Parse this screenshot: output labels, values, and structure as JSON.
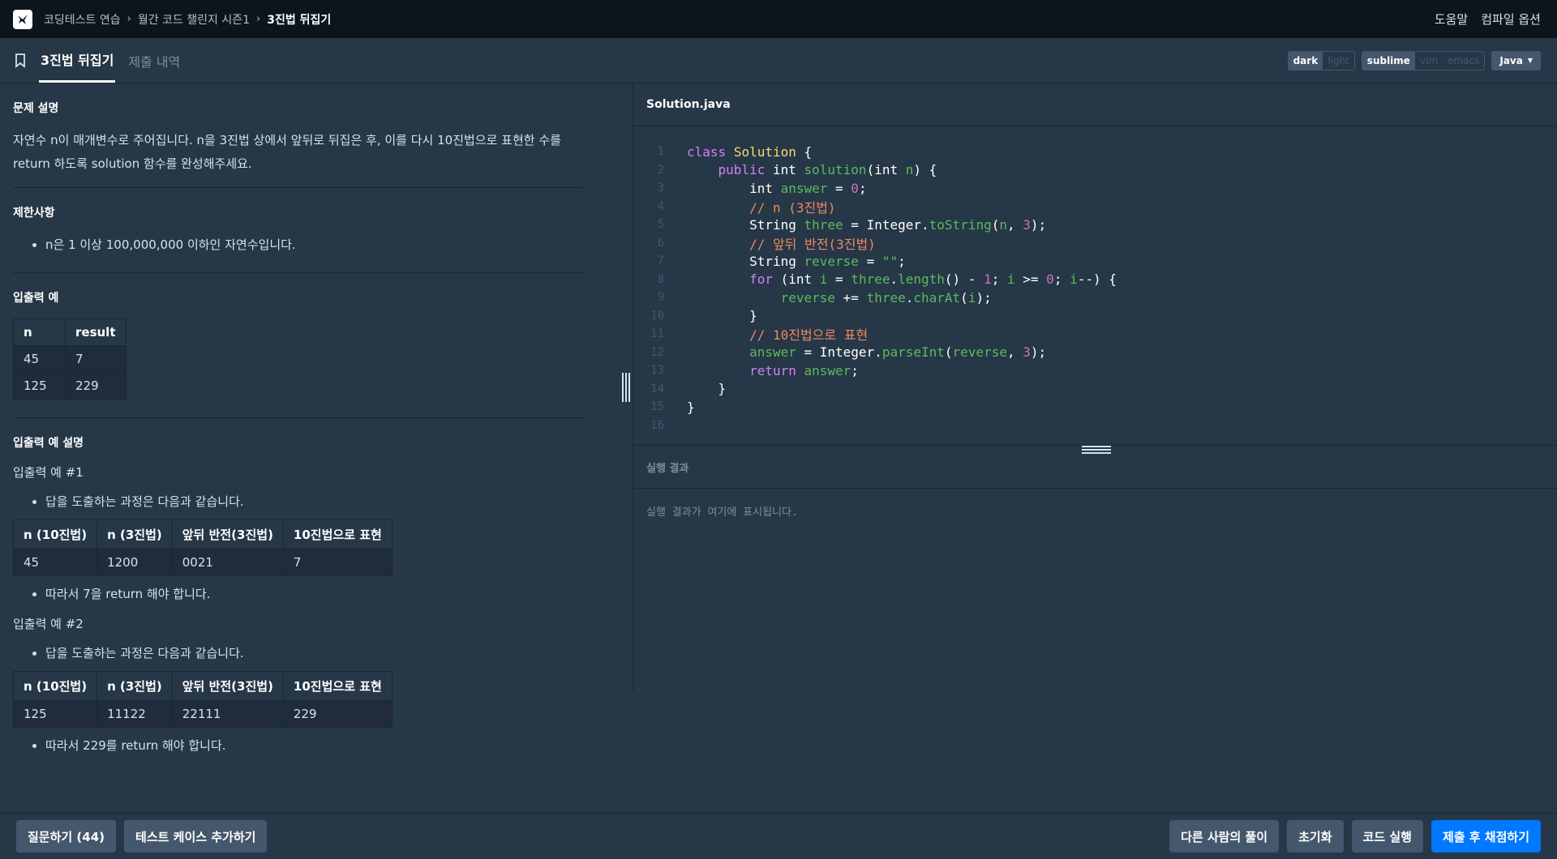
{
  "topbar": {
    "breadcrumbs": [
      "코딩테스트 연습",
      "월간 코드 챌린지 시즌1",
      "3진법 뒤집기"
    ],
    "help": "도움말",
    "compile_options": "컴파일 옵션"
  },
  "tabs": {
    "problem": "3진법 뒤집기",
    "submissions": "제출 내역"
  },
  "editor_options": {
    "themes": [
      "dark",
      "light"
    ],
    "keymaps": [
      "sublime",
      "vim",
      "emacs"
    ],
    "language": "Java"
  },
  "problem": {
    "description_title": "문제 설명",
    "description_line1": "자연수 n이 매개변수로 주어집니다. n을 3진법 상에서 앞뒤로 뒤집은 후, 이를 다시 10진법으로 표현한 수를",
    "description_line2": "return 하도록 solution 함수를 완성해주세요.",
    "constraints_title": "제한사항",
    "constraint1": "n은 1 이상 100,000,000 이하인 자연수입니다.",
    "io_title": "입출력 예",
    "io_headers": [
      "n",
      "result"
    ],
    "io_rows": [
      [
        "45",
        "7"
      ],
      [
        "125",
        "229"
      ]
    ],
    "explain_title": "입출력 예 설명",
    "ex1_title": "입출력 예 #1",
    "ex1_step": "답을 도출하는 과정은 다음과 같습니다.",
    "ex_headers": [
      "n (10진법)",
      "n (3진법)",
      "앞뒤 반전(3진법)",
      "10진법으로 표현"
    ],
    "ex1_row": [
      "45",
      "1200",
      "0021",
      "7"
    ],
    "ex1_result": "따라서 7을 return 해야 합니다.",
    "ex2_title": "입출력 예 #2",
    "ex2_step": "답을 도출하는 과정은 다음과 같습니다.",
    "ex2_row": [
      "125",
      "11122",
      "22111",
      "229"
    ],
    "ex2_result": "따라서 229를 return 해야 합니다."
  },
  "editor": {
    "filename": "Solution.java",
    "line_numbers": [
      "1",
      "2",
      "3",
      "4",
      "5",
      "6",
      "7",
      "8",
      "9",
      "10",
      "11",
      "12",
      "13",
      "14",
      "15",
      "16"
    ]
  },
  "result": {
    "title": "실행 결과",
    "placeholder": "실행 결과가 여기에 표시됩니다."
  },
  "bottom": {
    "question": "질문하기 (44)",
    "add_testcase": "테스트 케이스 추가하기",
    "others": "다른 사람의 풀이",
    "reset": "초기화",
    "run": "코드 실행",
    "submit": "제출 후 채점하기"
  }
}
